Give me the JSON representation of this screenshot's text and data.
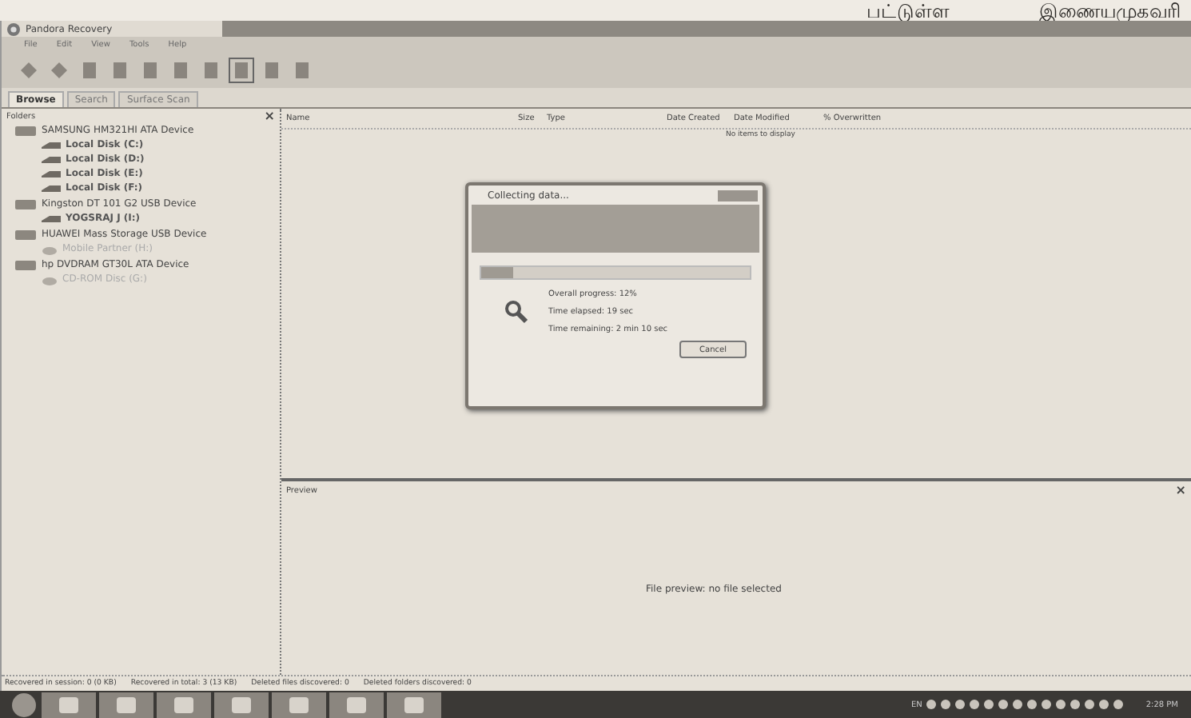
{
  "print_header": [
    "பட்டுள்ள",
    "இணையமுகவரி"
  ],
  "window": {
    "title": "Pandora Recovery"
  },
  "menu": [
    "File",
    "Edit",
    "View",
    "Tools",
    "Help"
  ],
  "tabs": [
    {
      "label": "Browse",
      "selected": true
    },
    {
      "label": "Search",
      "selected": false
    },
    {
      "label": "Surface Scan",
      "selected": false
    }
  ],
  "folders": {
    "title": "Folders",
    "close": "×",
    "tree": [
      {
        "label": "SAMSUNG HM321HI ATA Device",
        "disabled": false,
        "children": [
          {
            "label": "Local Disk (C:)",
            "kind": "volume",
            "disabled": false
          },
          {
            "label": "Local Disk (D:)",
            "kind": "volume",
            "disabled": false
          },
          {
            "label": "Local Disk (E:)",
            "kind": "volume",
            "disabled": false
          },
          {
            "label": "Local Disk (F:)",
            "kind": "volume",
            "disabled": false
          }
        ]
      },
      {
        "label": "Kingston DT 101 G2 USB Device",
        "disabled": false,
        "children": [
          {
            "label": "YOGSRAJ J (I:)",
            "kind": "volume",
            "disabled": false
          }
        ]
      },
      {
        "label": "HUAWEI Mass Storage USB Device",
        "disabled": false,
        "children": [
          {
            "label": "Mobile Partner (H:)",
            "kind": "disc",
            "disabled": true
          }
        ]
      },
      {
        "label": "hp DVDRAM GT30L ATA Device",
        "disabled": false,
        "children": [
          {
            "label": "CD-ROM Disc (G:)",
            "kind": "disc",
            "disabled": true
          }
        ]
      }
    ]
  },
  "table": {
    "columns": [
      "Name",
      "Size",
      "Type",
      "Date Created",
      "Date Modified",
      "% Overwritten"
    ],
    "empty": "No items to display"
  },
  "preview": {
    "title": "Preview",
    "close": "×",
    "message": "File preview: no file selected"
  },
  "dialog": {
    "title": "Collecting data...",
    "level": 0.12,
    "lines": [
      "Overall progress: 12%",
      "Time elapsed: 19 sec",
      "Time remaining: 2 min 10 sec"
    ],
    "button": "Cancel"
  },
  "status_bar": [
    "Recovered in session: 0 (0 KB)",
    "Recovered in total: 3 (13 KB)",
    "Deleted files discovered: 0",
    "Deleted folders discovered: 0"
  ],
  "taskbar": {
    "language": "EN",
    "clock": "2:28 PM"
  }
}
